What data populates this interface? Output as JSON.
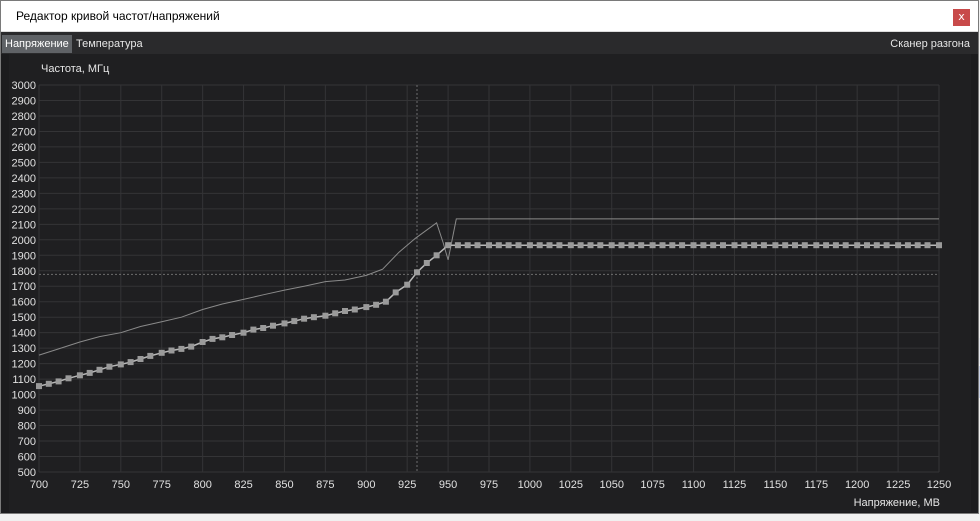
{
  "window": {
    "title": "Редактор кривой частот/напряжений",
    "close_label": "x"
  },
  "tabs": [
    {
      "label": "Напряжение",
      "active": true
    },
    {
      "label": "Температура",
      "active": false
    }
  ],
  "scanner_label": "Сканер разгона",
  "colors": {
    "chart_bg": "#1f1f21",
    "grid": "#343436",
    "curve": "#b8b8b8",
    "points": "#9a9a9a",
    "ref_line": "#6e6e6e",
    "close_bg": "#c84a4a"
  },
  "chart_data": {
    "type": "line",
    "ylabel": "Частота, МГц",
    "xlabel": "Напряжение, МВ",
    "xlim": [
      700,
      1250
    ],
    "ylim": [
      500,
      3000
    ],
    "xticks": [
      700,
      725,
      750,
      775,
      800,
      825,
      850,
      875,
      900,
      925,
      950,
      975,
      1000,
      1025,
      1050,
      1075,
      1100,
      1125,
      1150,
      1175,
      1200,
      1225,
      1250
    ],
    "yticks": [
      3000,
      2900,
      2800,
      2700,
      2600,
      2500,
      2400,
      2300,
      2200,
      2100,
      2000,
      1900,
      1800,
      1700,
      1600,
      1500,
      1400,
      1300,
      1200,
      1100,
      1000,
      900,
      800,
      700,
      600,
      500
    ],
    "grid": true,
    "cursor": {
      "x": 931,
      "y": 1777
    },
    "series": [
      {
        "style": "curve-with-points",
        "x": [
          700,
          706,
          712,
          718,
          725,
          731,
          737,
          743,
          750,
          756,
          762,
          768,
          775,
          781,
          787,
          793,
          800,
          806,
          812,
          818,
          825,
          831,
          837,
          843,
          850,
          856,
          862,
          868,
          875,
          881,
          887,
          893,
          900,
          906,
          912,
          918,
          925,
          931,
          937,
          943,
          950,
          956,
          962,
          968,
          975,
          981,
          987,
          993,
          1000,
          1006,
          1012,
          1018,
          1025,
          1031,
          1037,
          1043,
          1050,
          1056,
          1062,
          1068,
          1075,
          1081,
          1087,
          1093,
          1100,
          1106,
          1112,
          1118,
          1125,
          1131,
          1137,
          1143,
          1150,
          1156,
          1162,
          1168,
          1175,
          1181,
          1187,
          1193,
          1200,
          1206,
          1212,
          1218,
          1225,
          1231,
          1237,
          1243,
          1250
        ],
        "y": [
          1055,
          1070,
          1085,
          1105,
          1125,
          1140,
          1160,
          1180,
          1195,
          1210,
          1230,
          1250,
          1270,
          1285,
          1295,
          1310,
          1340,
          1360,
          1370,
          1385,
          1400,
          1420,
          1430,
          1445,
          1460,
          1475,
          1490,
          1500,
          1510,
          1525,
          1540,
          1550,
          1565,
          1580,
          1600,
          1660,
          1710,
          1790,
          1850,
          1900,
          1965,
          1965,
          1965,
          1965,
          1965,
          1965,
          1965,
          1965,
          1965,
          1965,
          1965,
          1965,
          1965,
          1965,
          1965,
          1965,
          1965,
          1965,
          1965,
          1965,
          1965,
          1965,
          1965,
          1965,
          1965,
          1965,
          1965,
          1965,
          1965,
          1965,
          1965,
          1965,
          1965,
          1965,
          1965,
          1965,
          1965,
          1965,
          1965,
          1965,
          1965,
          1965,
          1965,
          1965,
          1965,
          1965,
          1965,
          1965,
          1965
        ]
      },
      {
        "style": "thin-line",
        "x": [
          700,
          712,
          725,
          737,
          750,
          762,
          775,
          787,
          800,
          812,
          825,
          837,
          850,
          862,
          875,
          887,
          900,
          910,
          920,
          930,
          943,
          947,
          950,
          955,
          1250
        ],
        "y": [
          1255,
          1295,
          1340,
          1375,
          1400,
          1440,
          1470,
          1500,
          1550,
          1585,
          1615,
          1645,
          1675,
          1700,
          1730,
          1740,
          1770,
          1810,
          1920,
          2010,
          2110,
          1980,
          1870,
          2135,
          2135
        ]
      }
    ]
  }
}
